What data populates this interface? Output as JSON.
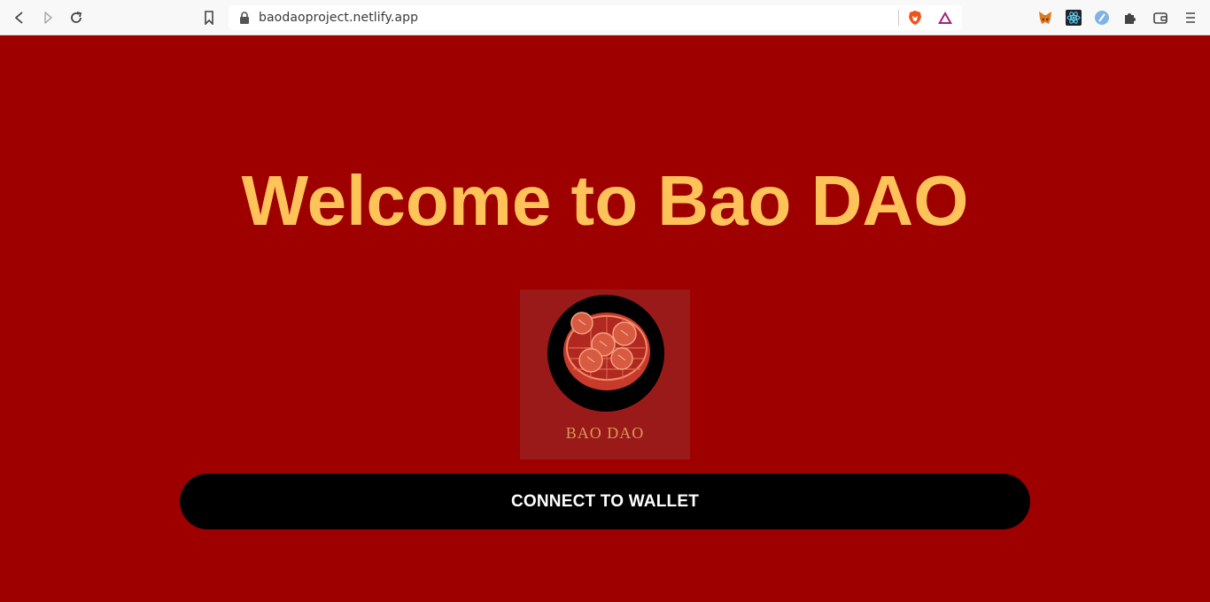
{
  "browser": {
    "url": "baodaoproject.netlify.app",
    "nav_icons": [
      "back-icon",
      "forward-icon",
      "reload-icon",
      "bookmark-icon"
    ],
    "toolbar_icons": [
      "brave-shields-icon",
      "brave-rewards-icon",
      "metamask-icon",
      "react-devtools-icon",
      "extension-icon",
      "puzzle-icon",
      "wallet-icon",
      "menu-icon"
    ]
  },
  "page": {
    "title": "Welcome to Bao DAO",
    "logo_text": "BAO DAO",
    "connect_button": "CONNECT TO WALLET"
  },
  "colors": {
    "background": "#9e0000",
    "title": "#ffc35a",
    "button": "#000000",
    "button_text": "#ffffff"
  }
}
